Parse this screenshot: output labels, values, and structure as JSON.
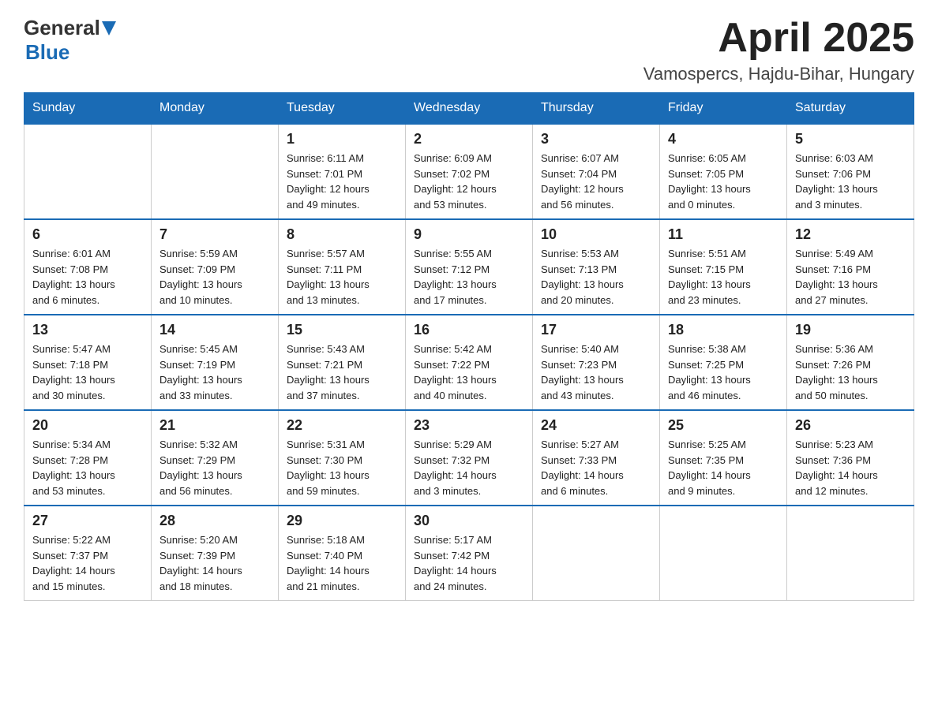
{
  "header": {
    "logo_general": "General",
    "logo_blue": "Blue",
    "month": "April 2025",
    "location": "Vamospercs, Hajdu-Bihar, Hungary"
  },
  "days_of_week": [
    "Sunday",
    "Monday",
    "Tuesday",
    "Wednesday",
    "Thursday",
    "Friday",
    "Saturday"
  ],
  "weeks": [
    [
      {
        "day": "",
        "info": ""
      },
      {
        "day": "",
        "info": ""
      },
      {
        "day": "1",
        "info": "Sunrise: 6:11 AM\nSunset: 7:01 PM\nDaylight: 12 hours\nand 49 minutes."
      },
      {
        "day": "2",
        "info": "Sunrise: 6:09 AM\nSunset: 7:02 PM\nDaylight: 12 hours\nand 53 minutes."
      },
      {
        "day": "3",
        "info": "Sunrise: 6:07 AM\nSunset: 7:04 PM\nDaylight: 12 hours\nand 56 minutes."
      },
      {
        "day": "4",
        "info": "Sunrise: 6:05 AM\nSunset: 7:05 PM\nDaylight: 13 hours\nand 0 minutes."
      },
      {
        "day": "5",
        "info": "Sunrise: 6:03 AM\nSunset: 7:06 PM\nDaylight: 13 hours\nand 3 minutes."
      }
    ],
    [
      {
        "day": "6",
        "info": "Sunrise: 6:01 AM\nSunset: 7:08 PM\nDaylight: 13 hours\nand 6 minutes."
      },
      {
        "day": "7",
        "info": "Sunrise: 5:59 AM\nSunset: 7:09 PM\nDaylight: 13 hours\nand 10 minutes."
      },
      {
        "day": "8",
        "info": "Sunrise: 5:57 AM\nSunset: 7:11 PM\nDaylight: 13 hours\nand 13 minutes."
      },
      {
        "day": "9",
        "info": "Sunrise: 5:55 AM\nSunset: 7:12 PM\nDaylight: 13 hours\nand 17 minutes."
      },
      {
        "day": "10",
        "info": "Sunrise: 5:53 AM\nSunset: 7:13 PM\nDaylight: 13 hours\nand 20 minutes."
      },
      {
        "day": "11",
        "info": "Sunrise: 5:51 AM\nSunset: 7:15 PM\nDaylight: 13 hours\nand 23 minutes."
      },
      {
        "day": "12",
        "info": "Sunrise: 5:49 AM\nSunset: 7:16 PM\nDaylight: 13 hours\nand 27 minutes."
      }
    ],
    [
      {
        "day": "13",
        "info": "Sunrise: 5:47 AM\nSunset: 7:18 PM\nDaylight: 13 hours\nand 30 minutes."
      },
      {
        "day": "14",
        "info": "Sunrise: 5:45 AM\nSunset: 7:19 PM\nDaylight: 13 hours\nand 33 minutes."
      },
      {
        "day": "15",
        "info": "Sunrise: 5:43 AM\nSunset: 7:21 PM\nDaylight: 13 hours\nand 37 minutes."
      },
      {
        "day": "16",
        "info": "Sunrise: 5:42 AM\nSunset: 7:22 PM\nDaylight: 13 hours\nand 40 minutes."
      },
      {
        "day": "17",
        "info": "Sunrise: 5:40 AM\nSunset: 7:23 PM\nDaylight: 13 hours\nand 43 minutes."
      },
      {
        "day": "18",
        "info": "Sunrise: 5:38 AM\nSunset: 7:25 PM\nDaylight: 13 hours\nand 46 minutes."
      },
      {
        "day": "19",
        "info": "Sunrise: 5:36 AM\nSunset: 7:26 PM\nDaylight: 13 hours\nand 50 minutes."
      }
    ],
    [
      {
        "day": "20",
        "info": "Sunrise: 5:34 AM\nSunset: 7:28 PM\nDaylight: 13 hours\nand 53 minutes."
      },
      {
        "day": "21",
        "info": "Sunrise: 5:32 AM\nSunset: 7:29 PM\nDaylight: 13 hours\nand 56 minutes."
      },
      {
        "day": "22",
        "info": "Sunrise: 5:31 AM\nSunset: 7:30 PM\nDaylight: 13 hours\nand 59 minutes."
      },
      {
        "day": "23",
        "info": "Sunrise: 5:29 AM\nSunset: 7:32 PM\nDaylight: 14 hours\nand 3 minutes."
      },
      {
        "day": "24",
        "info": "Sunrise: 5:27 AM\nSunset: 7:33 PM\nDaylight: 14 hours\nand 6 minutes."
      },
      {
        "day": "25",
        "info": "Sunrise: 5:25 AM\nSunset: 7:35 PM\nDaylight: 14 hours\nand 9 minutes."
      },
      {
        "day": "26",
        "info": "Sunrise: 5:23 AM\nSunset: 7:36 PM\nDaylight: 14 hours\nand 12 minutes."
      }
    ],
    [
      {
        "day": "27",
        "info": "Sunrise: 5:22 AM\nSunset: 7:37 PM\nDaylight: 14 hours\nand 15 minutes."
      },
      {
        "day": "28",
        "info": "Sunrise: 5:20 AM\nSunset: 7:39 PM\nDaylight: 14 hours\nand 18 minutes."
      },
      {
        "day": "29",
        "info": "Sunrise: 5:18 AM\nSunset: 7:40 PM\nDaylight: 14 hours\nand 21 minutes."
      },
      {
        "day": "30",
        "info": "Sunrise: 5:17 AM\nSunset: 7:42 PM\nDaylight: 14 hours\nand 24 minutes."
      },
      {
        "day": "",
        "info": ""
      },
      {
        "day": "",
        "info": ""
      },
      {
        "day": "",
        "info": ""
      }
    ]
  ]
}
